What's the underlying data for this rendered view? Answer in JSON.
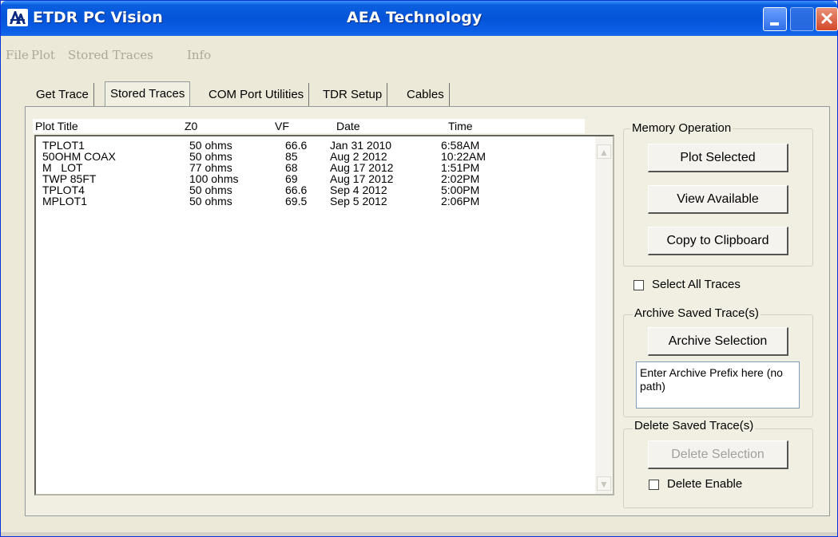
{
  "window": {
    "app_title": "ETDR PC Vision",
    "company_title": "AEA Technology",
    "icon": "aea-logo-icon",
    "controls": [
      "minimize-icon",
      "maximize-icon",
      "close-icon"
    ]
  },
  "menu": {
    "items": [
      "File",
      "Plot",
      "Stored Traces",
      "Info"
    ]
  },
  "tabs": [
    {
      "label": "Get Trace",
      "active": false
    },
    {
      "label": "Stored Traces",
      "active": true
    },
    {
      "label": "COM Port Utilities",
      "active": false
    },
    {
      "label": "TDR Setup",
      "active": false
    },
    {
      "label": "Cables",
      "active": false
    }
  ],
  "trace_list": {
    "columns": [
      "Plot Title",
      "Z0",
      "VF",
      "Date",
      "Time"
    ],
    "rows": [
      [
        "TPLOT1",
        "50 ohms",
        "66.6",
        "Jan 31 2010",
        "6:58AM"
      ],
      [
        "50OHM COAX",
        "50 ohms",
        "85",
        "Aug 2 2012",
        "10:22AM"
      ],
      [
        "M   LOT",
        "77 ohms",
        "68",
        "Aug 17 2012",
        "1:51PM"
      ],
      [
        "TWP 85FT",
        "100 ohms",
        "69",
        "Aug 17 2012",
        "2:02PM"
      ],
      [
        "TPLOT4",
        "50 ohms",
        "66.6",
        "Sep 4 2012",
        "5:00PM"
      ],
      [
        "MPLOT1",
        "50 ohms",
        "69.5",
        "Sep 5 2012",
        "2:06PM"
      ]
    ]
  },
  "memory_operation": {
    "label": "Memory Operation",
    "plot_selected": "Plot Selected",
    "view_available": "View Available",
    "copy_clipboard": "Copy to Clipboard"
  },
  "select_all": {
    "label": "Select All Traces",
    "checked": false
  },
  "archive": {
    "label": "Archive Saved Trace(s)",
    "button": "Archive Selection",
    "prefix_text": "Enter Archive Prefix here (no path)"
  },
  "delete": {
    "label": "Delete Saved Trace(s)",
    "button": "Delete Selection",
    "enable_label": "Delete Enable",
    "enable_checked": false
  },
  "colors": {
    "titlebar": "#0554d8",
    "face": "#ece9d8",
    "disabled_text": "#a0a0a0"
  }
}
